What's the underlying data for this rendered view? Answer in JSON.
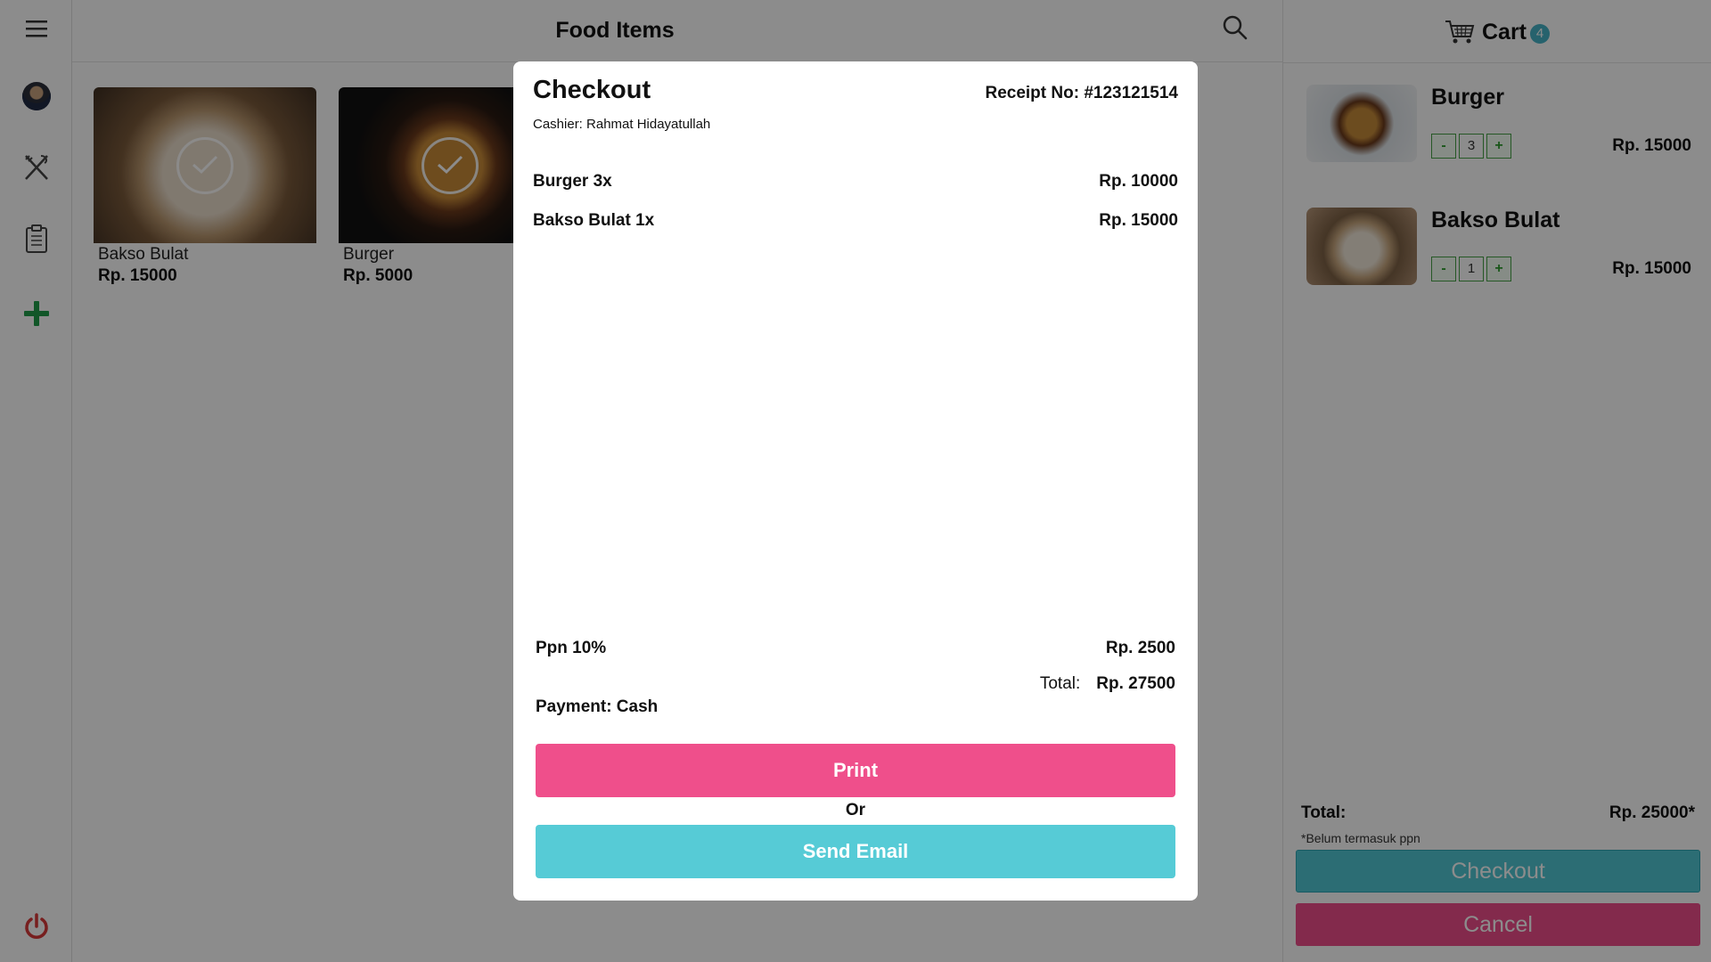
{
  "topbar": {
    "title": "Food Items"
  },
  "food_items": [
    {
      "name": "Bakso Bulat",
      "price": "Rp. 15000",
      "selected": true
    },
    {
      "name": "Burger",
      "price": "Rp. 5000",
      "selected": true
    }
  ],
  "cart": {
    "title": "Cart",
    "badge": "4",
    "items": [
      {
        "name": "Burger",
        "qty": "3",
        "price": "Rp. 15000",
        "minus": "-",
        "plus": "+"
      },
      {
        "name": "Bakso Bulat",
        "qty": "1",
        "price": "Rp. 15000",
        "minus": "-",
        "plus": "+"
      }
    ],
    "total_label": "Total:",
    "total_value": "Rp. 25000*",
    "note": "*Belum termasuk ppn",
    "checkout_label": "Checkout",
    "cancel_label": "Cancel"
  },
  "modal": {
    "title": "Checkout",
    "receipt": "Receipt No: #123121514",
    "cashier": "Cashier: Rahmat Hidayatullah",
    "lines": [
      {
        "item": "Burger 3x",
        "amount": "Rp. 10000"
      },
      {
        "item": "Bakso Bulat 1x",
        "amount": "Rp. 15000"
      }
    ],
    "ppn_label": "Ppn 10%",
    "ppn_value": "Rp. 2500",
    "total_label": "Total:",
    "total_value": "Rp. 27500",
    "payment": "Payment: Cash",
    "print_label": "Print",
    "or_label": "Or",
    "email_label": "Send Email"
  },
  "colors": {
    "pink": "#ef4f8b",
    "teal": "#56cbd6",
    "green": "#2f9d2f",
    "power_red": "#d93a3a"
  },
  "icons": [
    "hamburger-menu-icon",
    "avatar",
    "utensils-icon",
    "clipboard-icon",
    "plus-icon",
    "power-icon",
    "search-icon",
    "cart-icon",
    "check-icon"
  ]
}
